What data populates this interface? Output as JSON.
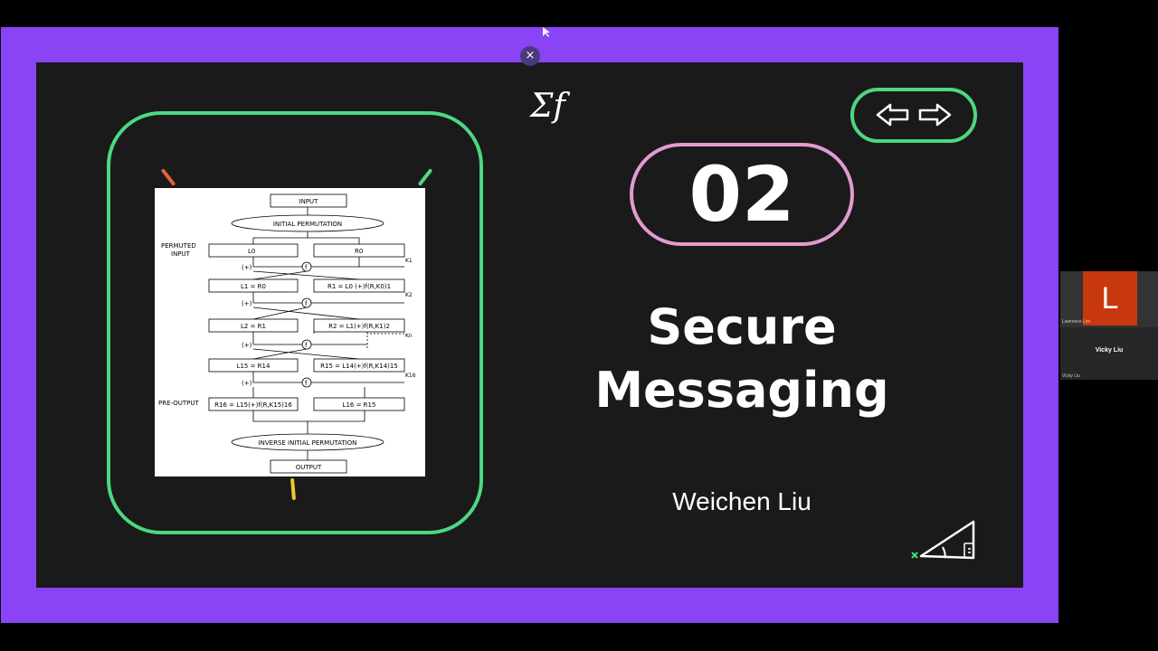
{
  "slide": {
    "number": "02",
    "title_line1": "Secure",
    "title_line2": "Messaging",
    "author": "Weichen Liu",
    "deco_text": "Σf",
    "close_glyph": "×"
  },
  "diagram": {
    "input": "INPUT",
    "initial_permutation": "INITIAL PERMUTATION",
    "permuted_input_line1": "PERMUTED",
    "permuted_input_line2": "INPUT",
    "l0": "L0",
    "r0": "R0",
    "k1": "K1",
    "k2": "K2",
    "kn": "Kn",
    "k16": "K16",
    "l1": "L1 = R0",
    "r1": "R1 = L0 (+)f(R,K0)1",
    "l2": "L2 = R1",
    "r2": "R2 = L1(+)f(R,K1)2",
    "l15": "L15 = R14",
    "r15": "R15 = L14(+)f(R,K14)15",
    "pre_output": "PRE-OUTPUT",
    "r16": "R16 = L15(+)f(R,K15)16",
    "l16": "L16 = R15",
    "inverse_permutation": "INVERSE INITIAL PERMUTATION",
    "output": "OUTPUT",
    "xor": "(+)",
    "f": "f"
  },
  "participants": {
    "active_initial": "L",
    "active_name": "Lawrence Lim",
    "speaker_name": "Vicky Liu",
    "speaker_label": "Vicky Liu"
  },
  "colors": {
    "frame": "#8a44f5",
    "slide_bg": "#1a1a1a",
    "green": "#4cd882",
    "pink": "#e39ad1",
    "avatar": "#c8380f"
  }
}
